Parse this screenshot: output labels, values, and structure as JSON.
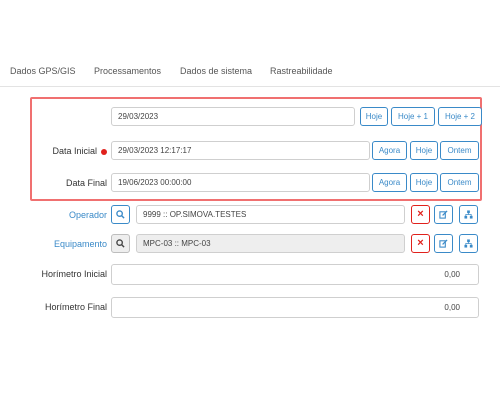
{
  "tabs": [
    "Dados GPS/GIS",
    "Processamentos",
    "Dados de sistema",
    "Rastreabilidade"
  ],
  "date_row": {
    "value": "29/03/2023",
    "buttons": [
      "Hoje",
      "Hoje + 1",
      "Hoje + 2"
    ]
  },
  "data_inicial": {
    "label": "Data Inicial",
    "value": "29/03/2023 12:17:17",
    "buttons": [
      "Agora",
      "Hoje",
      "Ontem"
    ]
  },
  "data_final": {
    "label": "Data Final",
    "value": "19/06/2023 00:00:00",
    "buttons": [
      "Agora",
      "Hoje",
      "Ontem"
    ]
  },
  "operador": {
    "label": "Operador",
    "value": "9999 :: OP.SIMOVA.TESTES"
  },
  "equipamento": {
    "label": "Equipamento",
    "value": "MPC-03 :: MPC-03"
  },
  "horimetro_inicial": {
    "label": "Horímetro Inicial",
    "value": "0,00"
  },
  "horimetro_final": {
    "label": "Horímetro Final",
    "value": "0,00"
  },
  "colors": {
    "accent": "#3a8ac8",
    "danger": "#e0211c",
    "highlight": "#f07070"
  },
  "icons": [
    "search-icon",
    "close-icon",
    "edit-icon",
    "hierarchy-icon"
  ]
}
